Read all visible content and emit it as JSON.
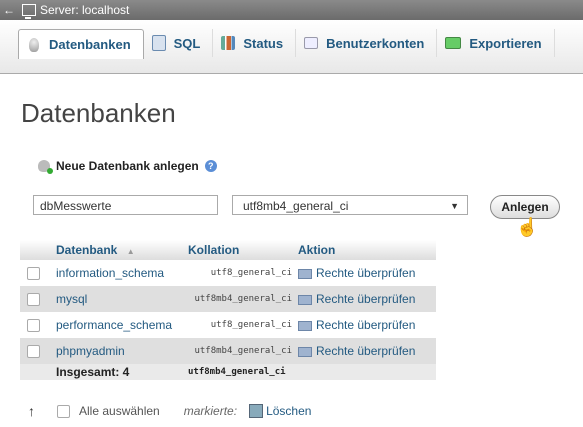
{
  "server": {
    "arrow": "←",
    "title": "Server: localhost"
  },
  "tabs": [
    {
      "label": "Datenbanken",
      "icon": "database-icon"
    },
    {
      "label": "SQL",
      "icon": "sql-icon"
    },
    {
      "label": "Status",
      "icon": "status-icon"
    },
    {
      "label": "Benutzerkonten",
      "icon": "users-icon"
    },
    {
      "label": "Exportieren",
      "icon": "export-icon"
    }
  ],
  "page_title": "Datenbanken",
  "create": {
    "heading": "Neue Datenbank anlegen",
    "help_glyph": "?",
    "name_value": "dbMesswerte",
    "collation_value": "utf8mb4_general_ci",
    "caret": "▼",
    "button_label": "Anlegen"
  },
  "table": {
    "headers": {
      "db": "Datenbank",
      "sort": "▲",
      "collation": "Kollation",
      "action": "Aktion"
    },
    "rows": [
      {
        "name": "information_schema",
        "collation": "utf8_general_ci",
        "action": "Rechte überprüfen"
      },
      {
        "name": "mysql",
        "collation": "utf8mb4_general_ci",
        "action": "Rechte überprüfen"
      },
      {
        "name": "performance_schema",
        "collation": "utf8_general_ci",
        "action": "Rechte überprüfen"
      },
      {
        "name": "phpmyadmin",
        "collation": "utf8mb4_general_ci",
        "action": "Rechte überprüfen"
      }
    ],
    "total_label": "Insgesamt: 4",
    "total_collation": "utf8mb4_general_ci"
  },
  "footer": {
    "arrow": "↑",
    "select_all": "Alle auswählen",
    "marked": "markierte:",
    "delete": "Löschen"
  }
}
